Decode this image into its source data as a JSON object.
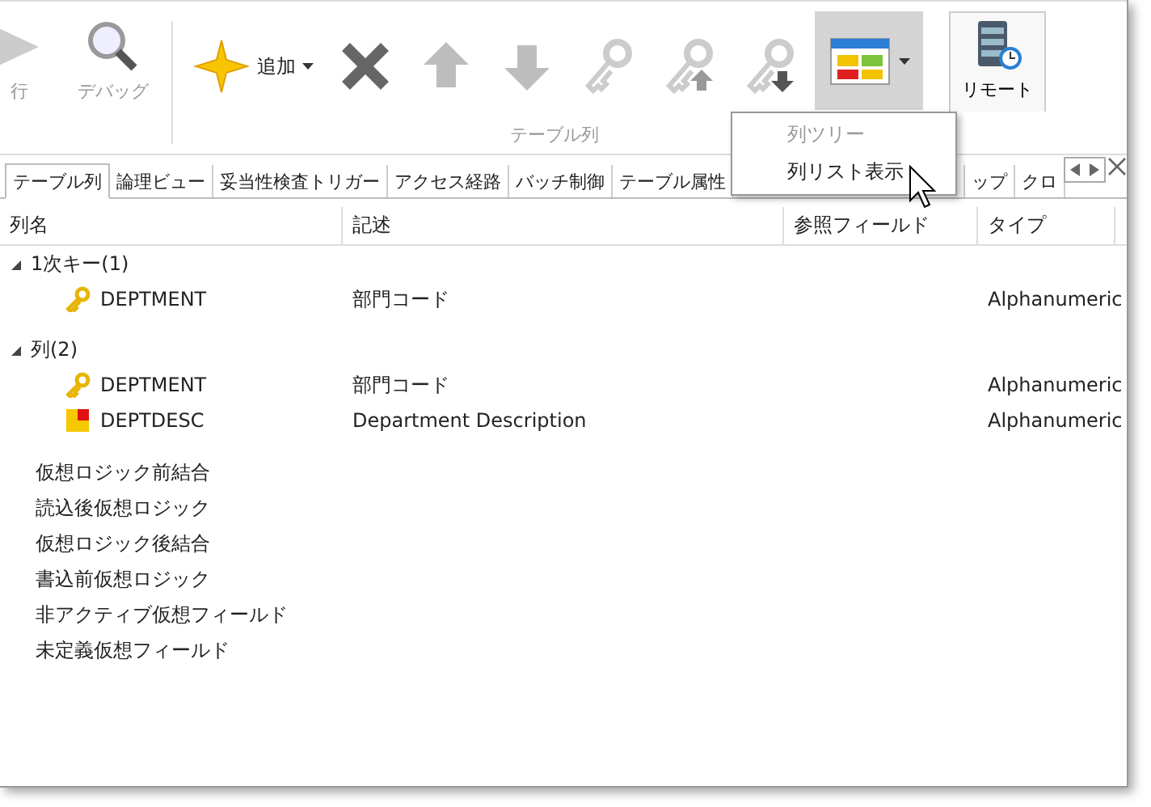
{
  "ribbon": {
    "left_buttons": [
      {
        "kind": "run",
        "label": "行",
        "disabled": true
      },
      {
        "kind": "debug",
        "label": "デバッグ",
        "disabled": true
      }
    ],
    "group": {
      "label": "テーブル列",
      "buttons": [
        {
          "kind": "add",
          "label": "追加",
          "disabled": false,
          "pressed": false,
          "dropdown": true
        },
        {
          "kind": "delete",
          "disabled": false,
          "pressed": false,
          "dropdown": false
        },
        {
          "kind": "up",
          "disabled": true,
          "pressed": false,
          "dropdown": false
        },
        {
          "kind": "down",
          "disabled": true,
          "pressed": false,
          "dropdown": false
        },
        {
          "kind": "key",
          "disabled": true,
          "pressed": false,
          "dropdown": false
        },
        {
          "kind": "key-up",
          "disabled": true,
          "pressed": false,
          "dropdown": false
        },
        {
          "kind": "key-down",
          "disabled": true,
          "pressed": false,
          "dropdown": false
        },
        {
          "kind": "view",
          "disabled": false,
          "pressed": true,
          "dropdown": true
        }
      ]
    },
    "remote": {
      "label": "リモート"
    }
  },
  "menu": {
    "items": [
      {
        "label": "列ツリー",
        "disabled": true
      },
      {
        "label": "列リスト表示",
        "disabled": false
      }
    ]
  },
  "tabs": [
    {
      "label": "テーブル列",
      "selected": true
    },
    {
      "label": "論理ビュー",
      "selected": false
    },
    {
      "label": "妥当性検査トリガー",
      "selected": false
    },
    {
      "label": "アクセス経路",
      "selected": false
    },
    {
      "label": "バッチ制御",
      "selected": false
    },
    {
      "label": "テーブル属性",
      "selected": false
    },
    {
      "label": "ップ",
      "selected": false
    },
    {
      "label": "クロ",
      "selected": false
    }
  ],
  "table": {
    "columns": [
      "列名",
      "記述",
      "参照フィールド",
      "タイプ"
    ],
    "groups": [
      {
        "label": "1次キー(1)",
        "expanded": true,
        "children": [
          {
            "kind": "key",
            "name": "DEPTMENT",
            "description": "部門コード",
            "type": "Alphanumeric"
          }
        ]
      },
      {
        "label": "列(2)",
        "expanded": true,
        "children": [
          {
            "kind": "key",
            "name": "DEPTMENT",
            "description": "部門コード",
            "type": "Alphanumeric"
          },
          {
            "kind": "field",
            "name": "DEPTDESC",
            "description": "Department Description",
            "type": "Alphanumeric"
          }
        ]
      }
    ],
    "virtual_items": [
      "仮想ロジック前結合",
      "読込後仮想ロジック",
      "仮想ロジック後結合",
      "書込前仮想ロジック",
      "非アクティブ仮想フィールド",
      "未定義仮想フィールド"
    ]
  }
}
